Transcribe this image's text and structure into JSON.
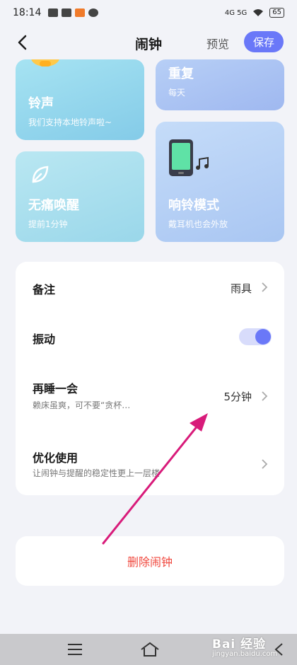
{
  "status_bar": {
    "time": "18:14",
    "network": "4G 5G",
    "battery": "65"
  },
  "header": {
    "title": "闹钟",
    "preview_label": "预览",
    "save_label": "保存"
  },
  "cards": {
    "ringtone": {
      "title": "铃声",
      "subtitle": "我们支持本地铃声啦~"
    },
    "repeat": {
      "title": "重复",
      "subtitle": "每天"
    },
    "painless": {
      "title": "无痛唤醒",
      "subtitle": "提前1分钟"
    },
    "ringmode": {
      "title": "响铃模式",
      "subtitle": "戴耳机也会外放"
    }
  },
  "settings": {
    "memo": {
      "label": "备注",
      "value": "雨具"
    },
    "vibrate": {
      "label": "振动",
      "enabled": true
    },
    "snooze": {
      "label": "再睡一会",
      "subtitle": "赖床虽爽，可不要“贪杯…",
      "value": "5分钟"
    },
    "optimize": {
      "label": "优化使用",
      "subtitle": "让闹钟与提醒的稳定性更上一层楼"
    }
  },
  "delete_label": "删除闹钟",
  "watermark": {
    "brand": "Bai 经验",
    "url": "jingyan.baidu.com"
  },
  "colors": {
    "accent": "#6a78f8",
    "danger": "#f0483e",
    "annotation_arrow": "#d81b7a"
  }
}
